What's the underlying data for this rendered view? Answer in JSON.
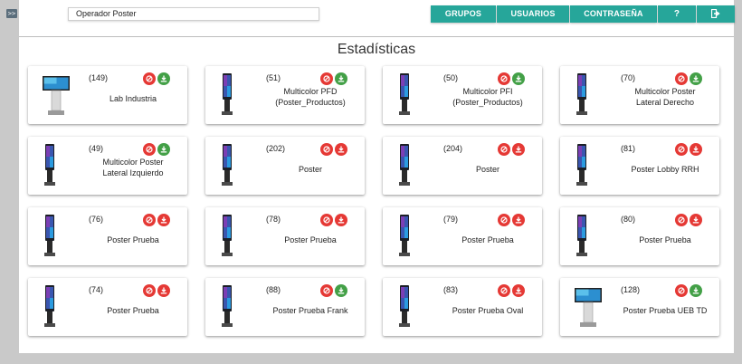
{
  "sidebar_toggle": ">>",
  "user_label": "Operador Poster",
  "nav": {
    "groups": "GRUPOS",
    "users": "USUARIOS",
    "password": "CONTRASEÑA",
    "help": "?"
  },
  "page_title": "Estadísticas",
  "colors": {
    "teal": "#26a69a",
    "red": "#e53935",
    "green": "#43a047"
  },
  "devices": [
    {
      "count": "(149)",
      "name": "Lab Industria",
      "image": "tv-kiosk-icon",
      "status": "green"
    },
    {
      "count": "(51)",
      "name": "Multicolor PFD\n(Poster_Productos)",
      "image": "totem-icon",
      "status": "green"
    },
    {
      "count": "(50)",
      "name": "Multicolor PFI\n(Poster_Productos)",
      "image": "totem-icon",
      "status": "green"
    },
    {
      "count": "(70)",
      "name": "Multicolor Poster\nLateral Derecho",
      "image": "totem-icon",
      "status": "green"
    },
    {
      "count": "(49)",
      "name": "Multicolor Poster\nLateral Izquierdo",
      "image": "totem-icon",
      "status": "green"
    },
    {
      "count": "(202)",
      "name": "Poster",
      "image": "totem-icon",
      "status": "red"
    },
    {
      "count": "(204)",
      "name": "Poster",
      "image": "totem-icon",
      "status": "red"
    },
    {
      "count": "(81)",
      "name": "Poster Lobby RRH",
      "image": "totem-icon",
      "status": "red"
    },
    {
      "count": "(76)",
      "name": "Poster Prueba",
      "image": "totem-icon",
      "status": "red"
    },
    {
      "count": "(78)",
      "name": "Poster Prueba",
      "image": "totem-icon",
      "status": "red"
    },
    {
      "count": "(79)",
      "name": "Poster Prueba",
      "image": "totem-icon",
      "status": "red"
    },
    {
      "count": "(80)",
      "name": "Poster Prueba",
      "image": "totem-icon",
      "status": "red"
    },
    {
      "count": "(74)",
      "name": "Poster Prueba",
      "image": "totem-icon",
      "status": "red"
    },
    {
      "count": "(88)",
      "name": "Poster Prueba Frank",
      "image": "totem-icon",
      "status": "green"
    },
    {
      "count": "(83)",
      "name": "Poster Prueba Oval",
      "image": "totem-icon",
      "status": "red"
    },
    {
      "count": "(128)",
      "name": "Poster Prueba UEB TD",
      "image": "tv-kiosk-icon",
      "status": "green"
    }
  ]
}
